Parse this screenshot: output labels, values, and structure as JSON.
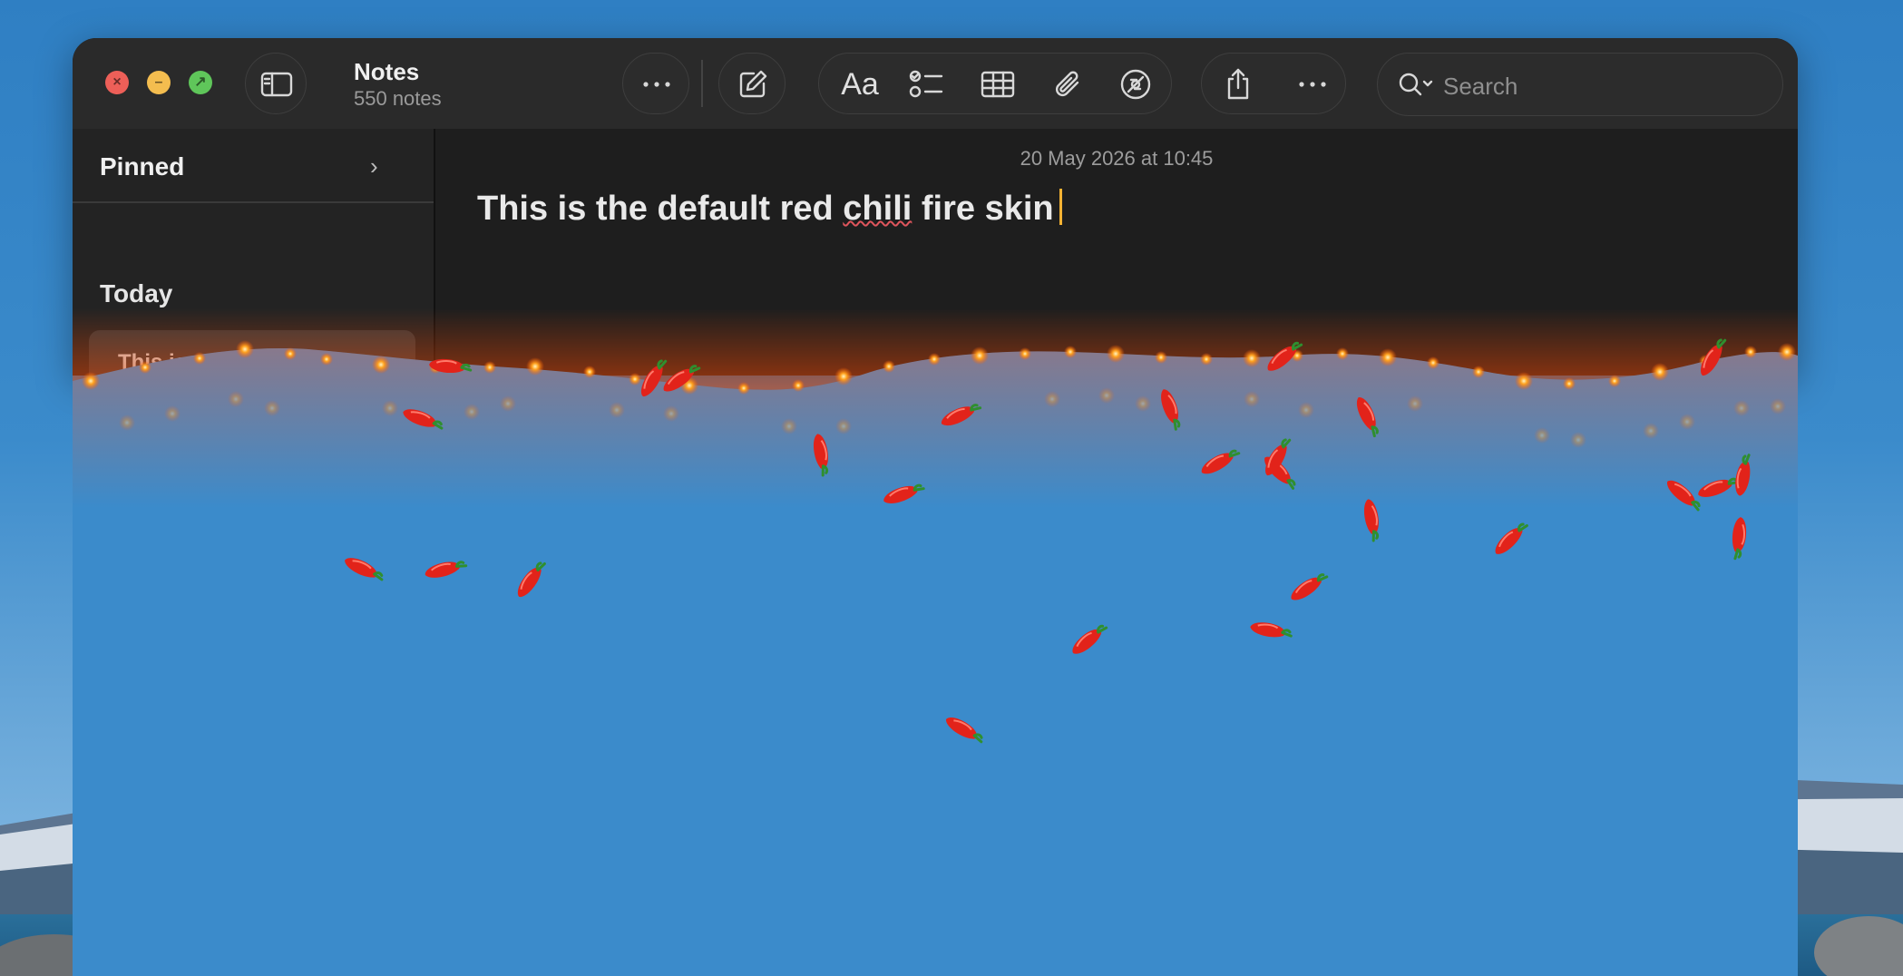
{
  "window": {
    "title": "Notes",
    "count": "550 notes"
  },
  "toolbar": {
    "sidebar_toggle_icon": "sidebar-icon",
    "more_icon": "ellipsis-icon",
    "compose_icon": "compose-icon",
    "format_label": "Aa",
    "checklist_icon": "checklist-icon",
    "table_icon": "table-icon",
    "attachment_icon": "paperclip-icon",
    "collab_icon": "collaboration-icon",
    "share_icon": "share-icon",
    "more2_icon": "ellipsis-icon"
  },
  "search": {
    "placeholder": "Search"
  },
  "sidebar": {
    "pinned_label": "Pinned",
    "today_label": "Today",
    "note_preview": "This is"
  },
  "note": {
    "date": "20 May 2026 at 10:45",
    "text_before": "This is the default red ",
    "text_misspelled": "chili",
    "text_after": " fire skin"
  },
  "colors": {
    "accent_caret": "#f3b233",
    "chili": "#e2231a",
    "stem": "#2f8f2f",
    "ember": "#ff8a1f"
  }
}
